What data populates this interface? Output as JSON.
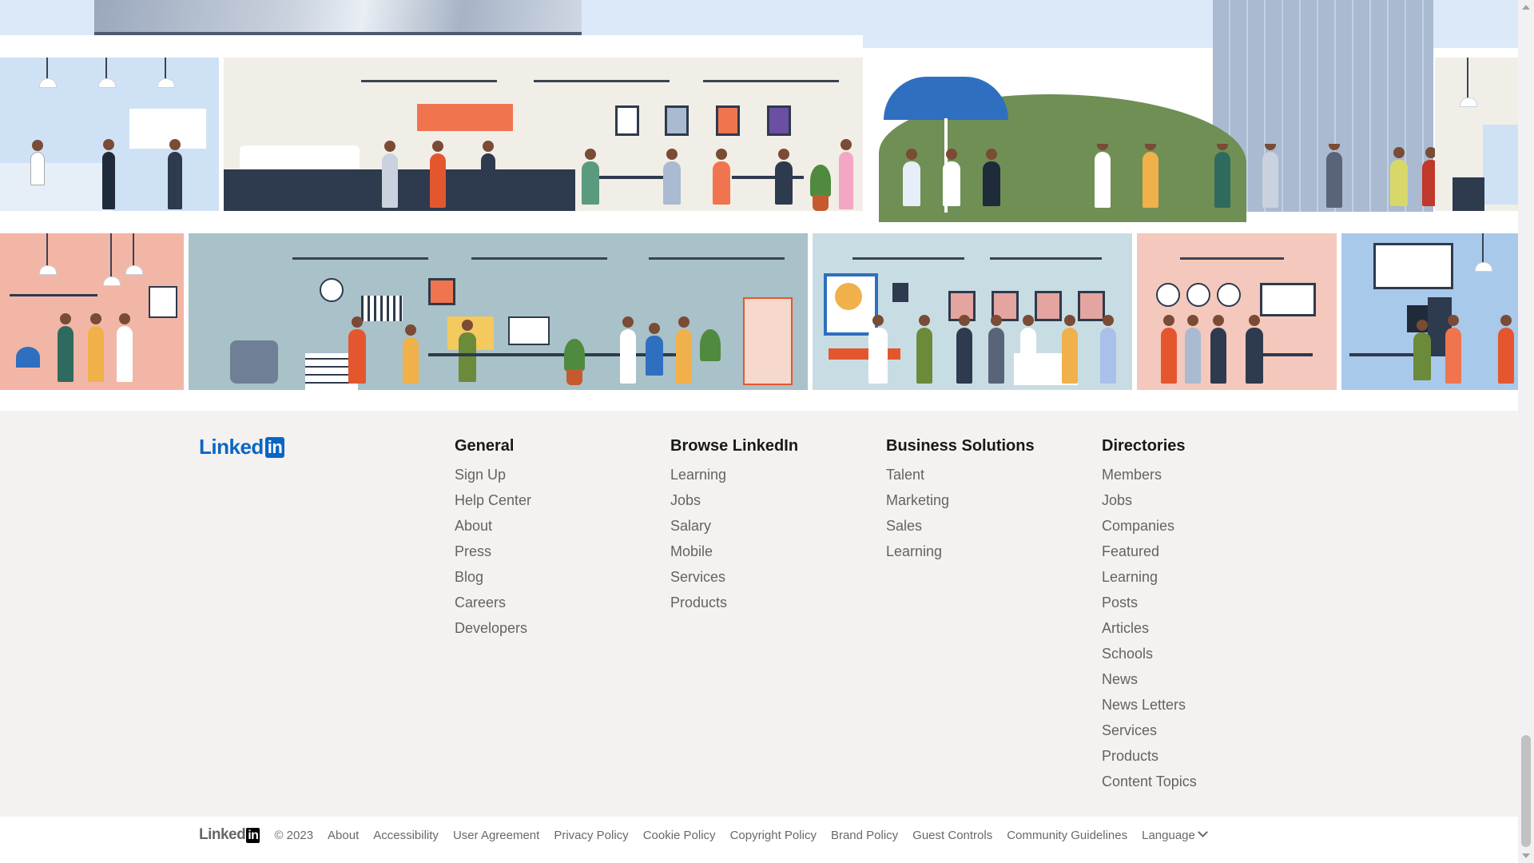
{
  "hero": {
    "illustration": "office-floors-illustration"
  },
  "brand": {
    "logo_word": "Linked",
    "logo_box": "in"
  },
  "footer": {
    "columns": [
      {
        "title": "General",
        "links": [
          "Sign Up",
          "Help Center",
          "About",
          "Press",
          "Blog",
          "Careers",
          "Developers"
        ]
      },
      {
        "title": "Browse LinkedIn",
        "links": [
          "Learning",
          "Jobs",
          "Salary",
          "Mobile",
          "Services",
          "Products"
        ]
      },
      {
        "title": "Business Solutions",
        "links": [
          "Talent",
          "Marketing",
          "Sales",
          "Learning"
        ]
      },
      {
        "title": "Directories",
        "links": [
          "Members",
          "Jobs",
          "Companies",
          "Featured",
          "Learning",
          "Posts",
          "Articles",
          "Schools",
          "News",
          "News Letters",
          "Services",
          "Products",
          "Content Topics"
        ]
      }
    ]
  },
  "legal": {
    "copyright": "© 2023",
    "links": [
      "About",
      "Accessibility",
      "User Agreement",
      "Privacy Policy",
      "Cookie Policy",
      "Copyright Policy",
      "Brand Policy",
      "Guest Controls",
      "Community Guidelines"
    ],
    "language_label": "Language"
  },
  "colors": {
    "brand_blue": "#0a66c2",
    "footer_bg": "#f3f2f0",
    "text_muted": "#666666"
  }
}
